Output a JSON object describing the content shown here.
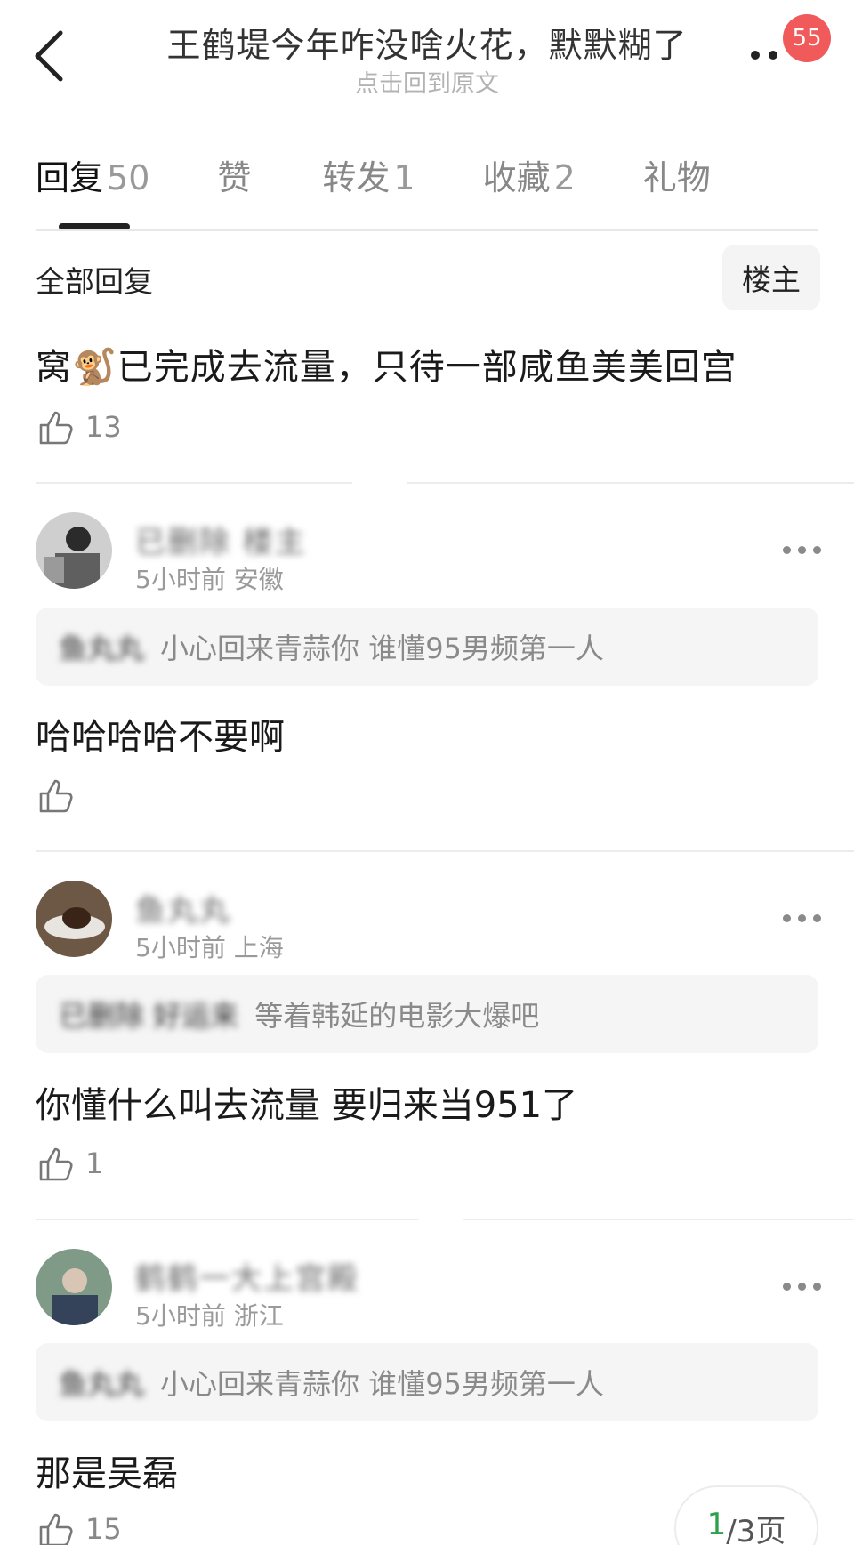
{
  "header": {
    "title": "王鹤堤今年咋没啥火花，默默糊了",
    "subtitle": "点击回到原文",
    "badge": "55"
  },
  "tabs": [
    {
      "label": "回复",
      "count": "50",
      "active": true
    },
    {
      "label": "赞",
      "count": ""
    },
    {
      "label": "转发",
      "count": "1"
    },
    {
      "label": "收藏",
      "count": "2"
    },
    {
      "label": "礼物",
      "count": ""
    }
  ],
  "section": {
    "title": "全部回复",
    "owner_button": "楼主"
  },
  "main_comment": {
    "text": "窝🐒已完成去流量，只待一部咸鱼美美回宫",
    "likes": "13"
  },
  "replies": [
    {
      "user": "已删除 楼主",
      "time": "5小时前 安徽",
      "quote_author": "鱼丸丸",
      "quote_text": "小心回来青蒜你 谁懂95男频第一人",
      "text": "哈哈哈哈不要啊",
      "likes": ""
    },
    {
      "user": "鱼丸丸",
      "time": "5小时前 上海",
      "quote_author": "已删除 好运来",
      "quote_text": "等着韩延的电影大爆吧",
      "text": "你懂什么叫去流量 要归来当951了",
      "likes": "1"
    },
    {
      "user": "鹤鹤一大上宫殿",
      "time": "5小时前 浙江",
      "quote_author": "鱼丸丸",
      "quote_text": "小心回来青蒜你 谁懂95男频第一人",
      "text": "那是吴磊",
      "likes": "15"
    }
  ],
  "pager": {
    "current": "1",
    "total": "/3页"
  }
}
